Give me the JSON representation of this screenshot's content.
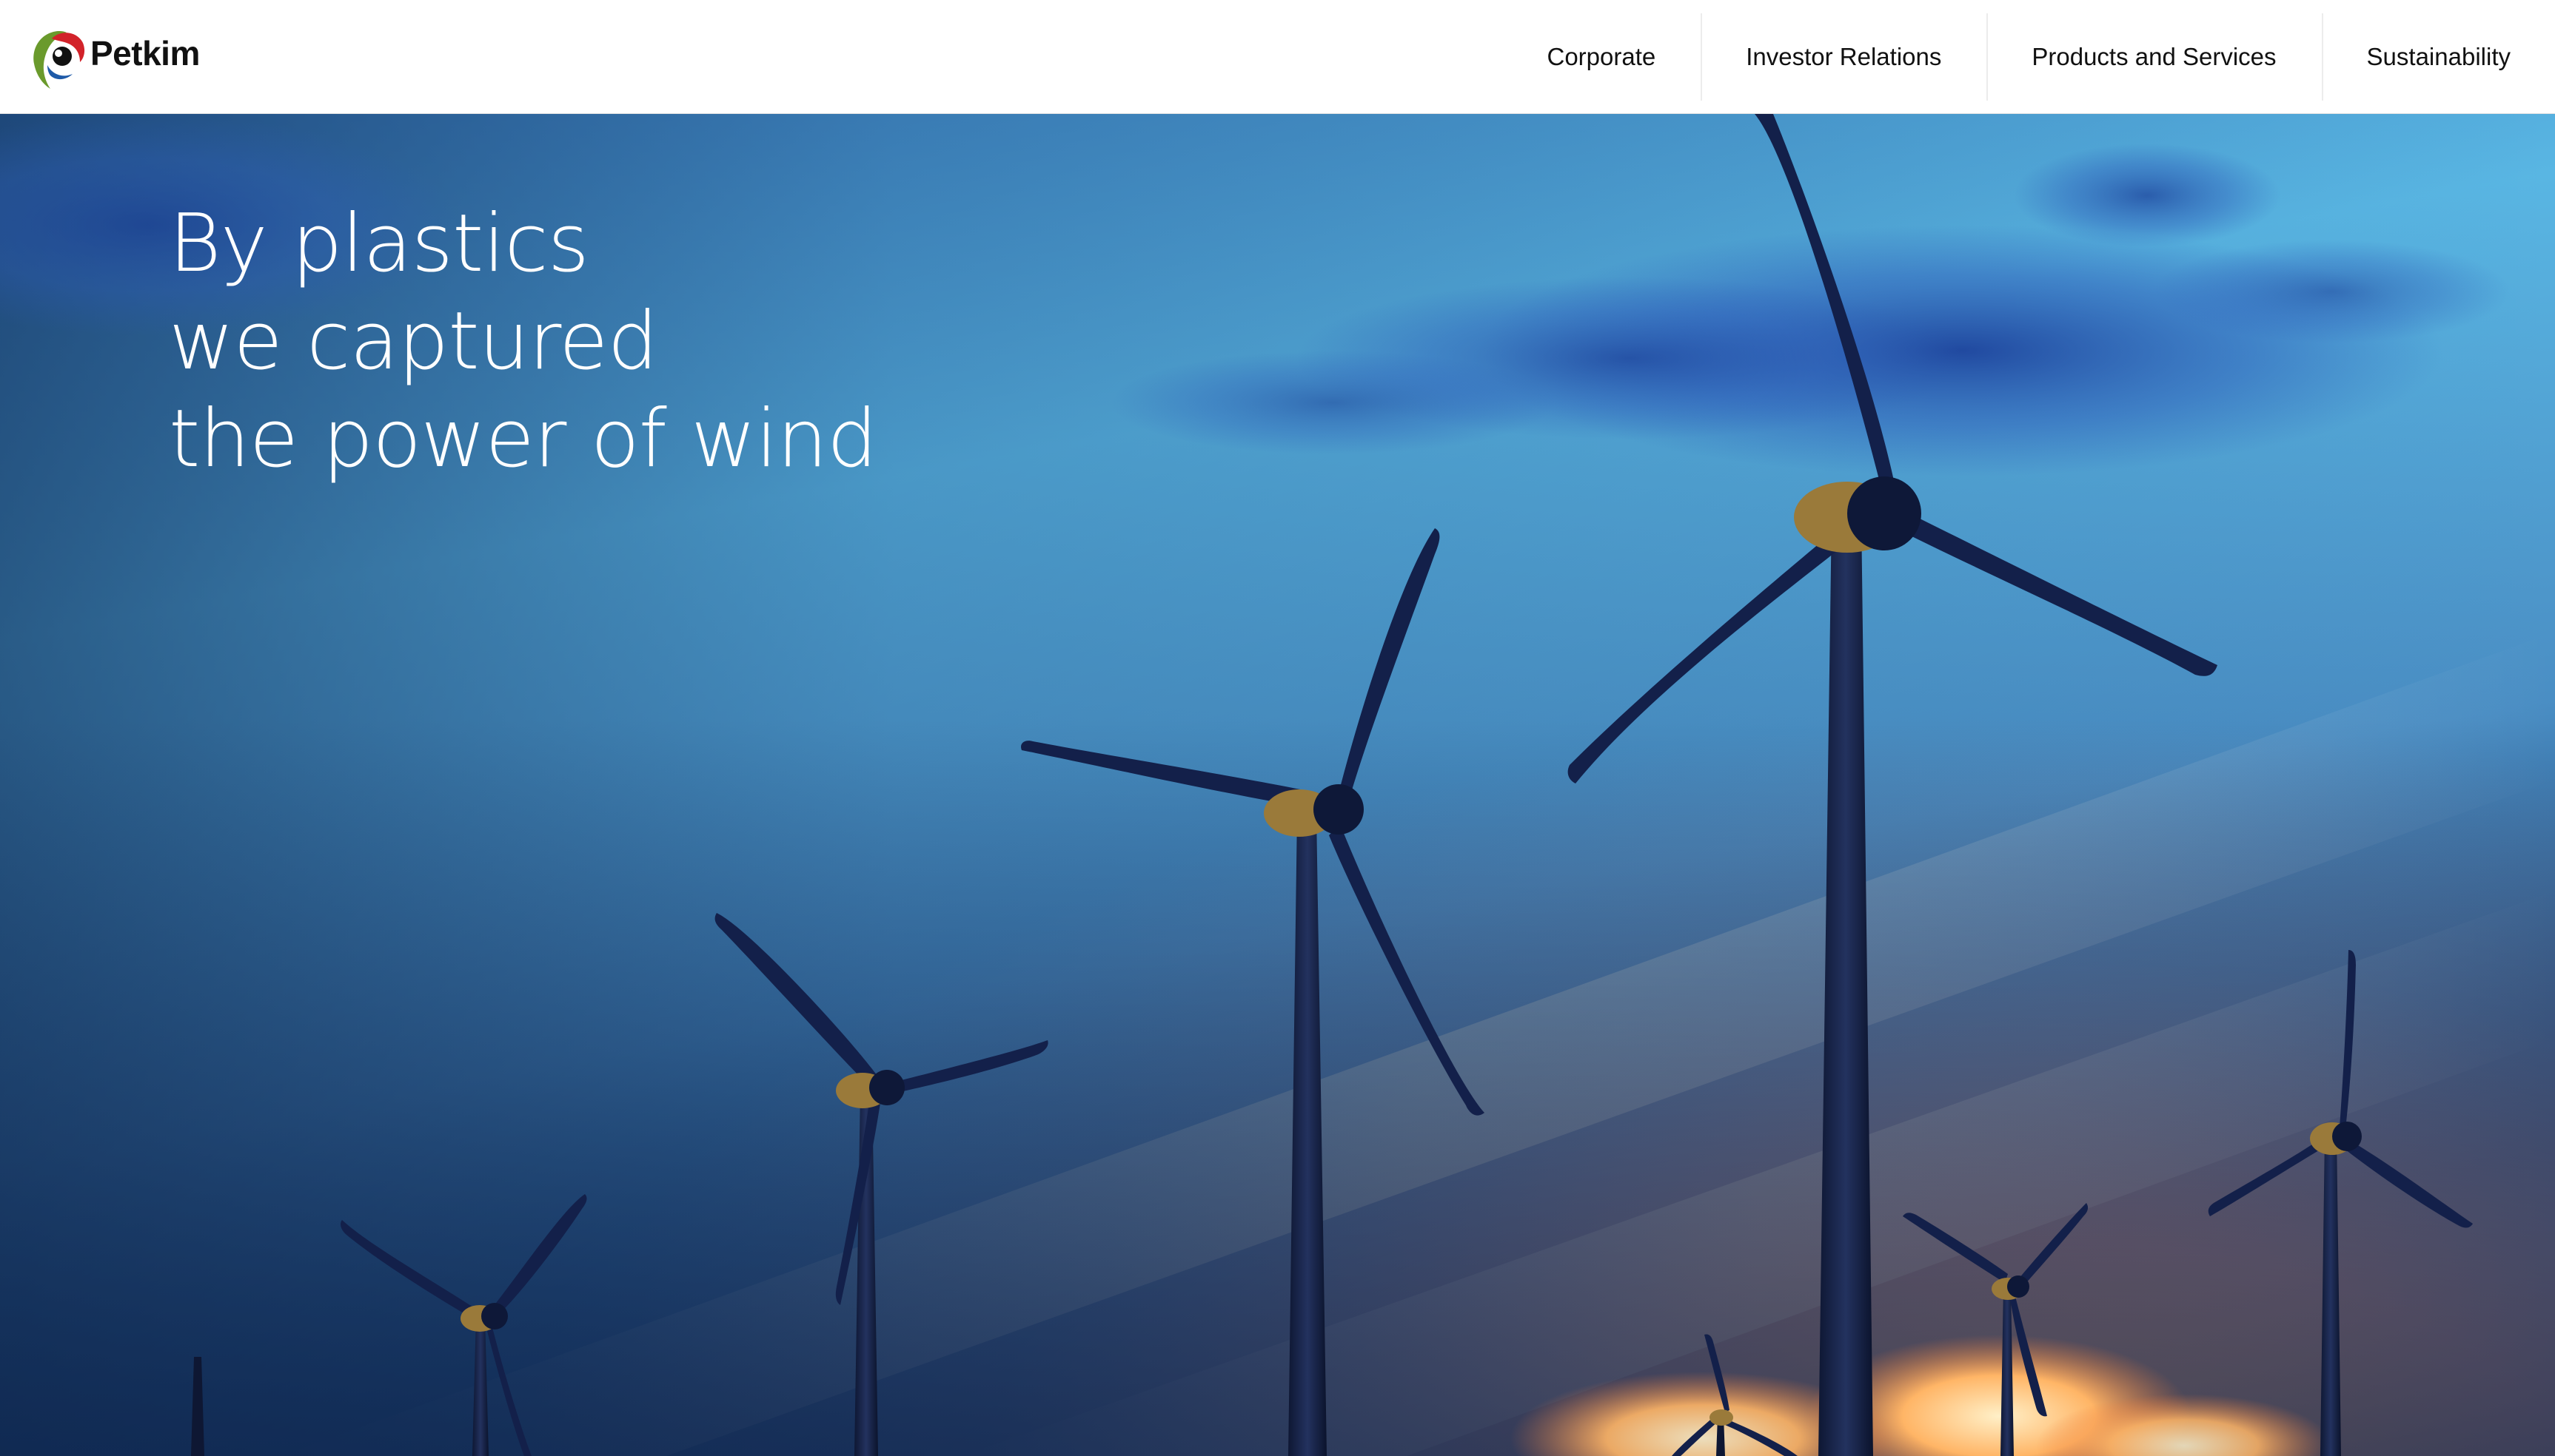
{
  "brand": {
    "name": "Petkim",
    "colors": {
      "green": "#6a9a2c",
      "red": "#d2232a",
      "blue": "#1e5aa8",
      "dark": "#111111"
    }
  },
  "nav": {
    "items": [
      {
        "label": "Corporate"
      },
      {
        "label": "Investor Relations"
      },
      {
        "label": "Products and Services"
      },
      {
        "label": "Sustainability"
      }
    ]
  },
  "hero": {
    "headline_lines": [
      "By plastics",
      "we captured",
      "the power of wind"
    ],
    "image": "wind-turbines-at-sunset",
    "colors": {
      "sky_top": "#3f86c2",
      "sky_mid": "#5bbde7",
      "horizon_glow": "#f0b187",
      "cloud_glow": "#ffb36a",
      "turbine": "#13204a"
    }
  }
}
